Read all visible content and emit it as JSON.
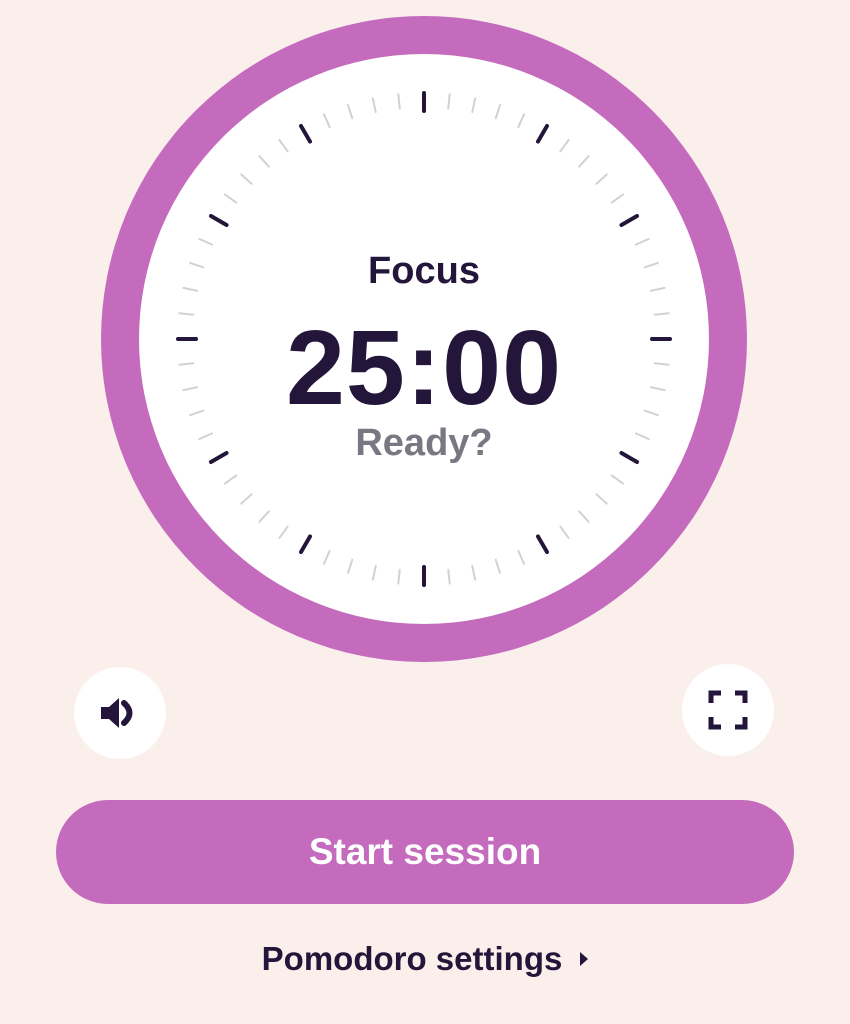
{
  "timer": {
    "mode_label": "Focus",
    "time": "25:00",
    "status": "Ready?"
  },
  "controls": {
    "sound_icon": "speaker-volume-icon",
    "fullscreen_icon": "fullscreen-expand-icon"
  },
  "actions": {
    "start_label": "Start session",
    "settings_label": "Pomodoro settings",
    "settings_chevron_icon": "chevron-right-icon"
  },
  "colors": {
    "background": "#FBEFEC",
    "accent": "#C46BBD",
    "text_primary": "#24163A",
    "text_secondary": "#7A7682"
  }
}
